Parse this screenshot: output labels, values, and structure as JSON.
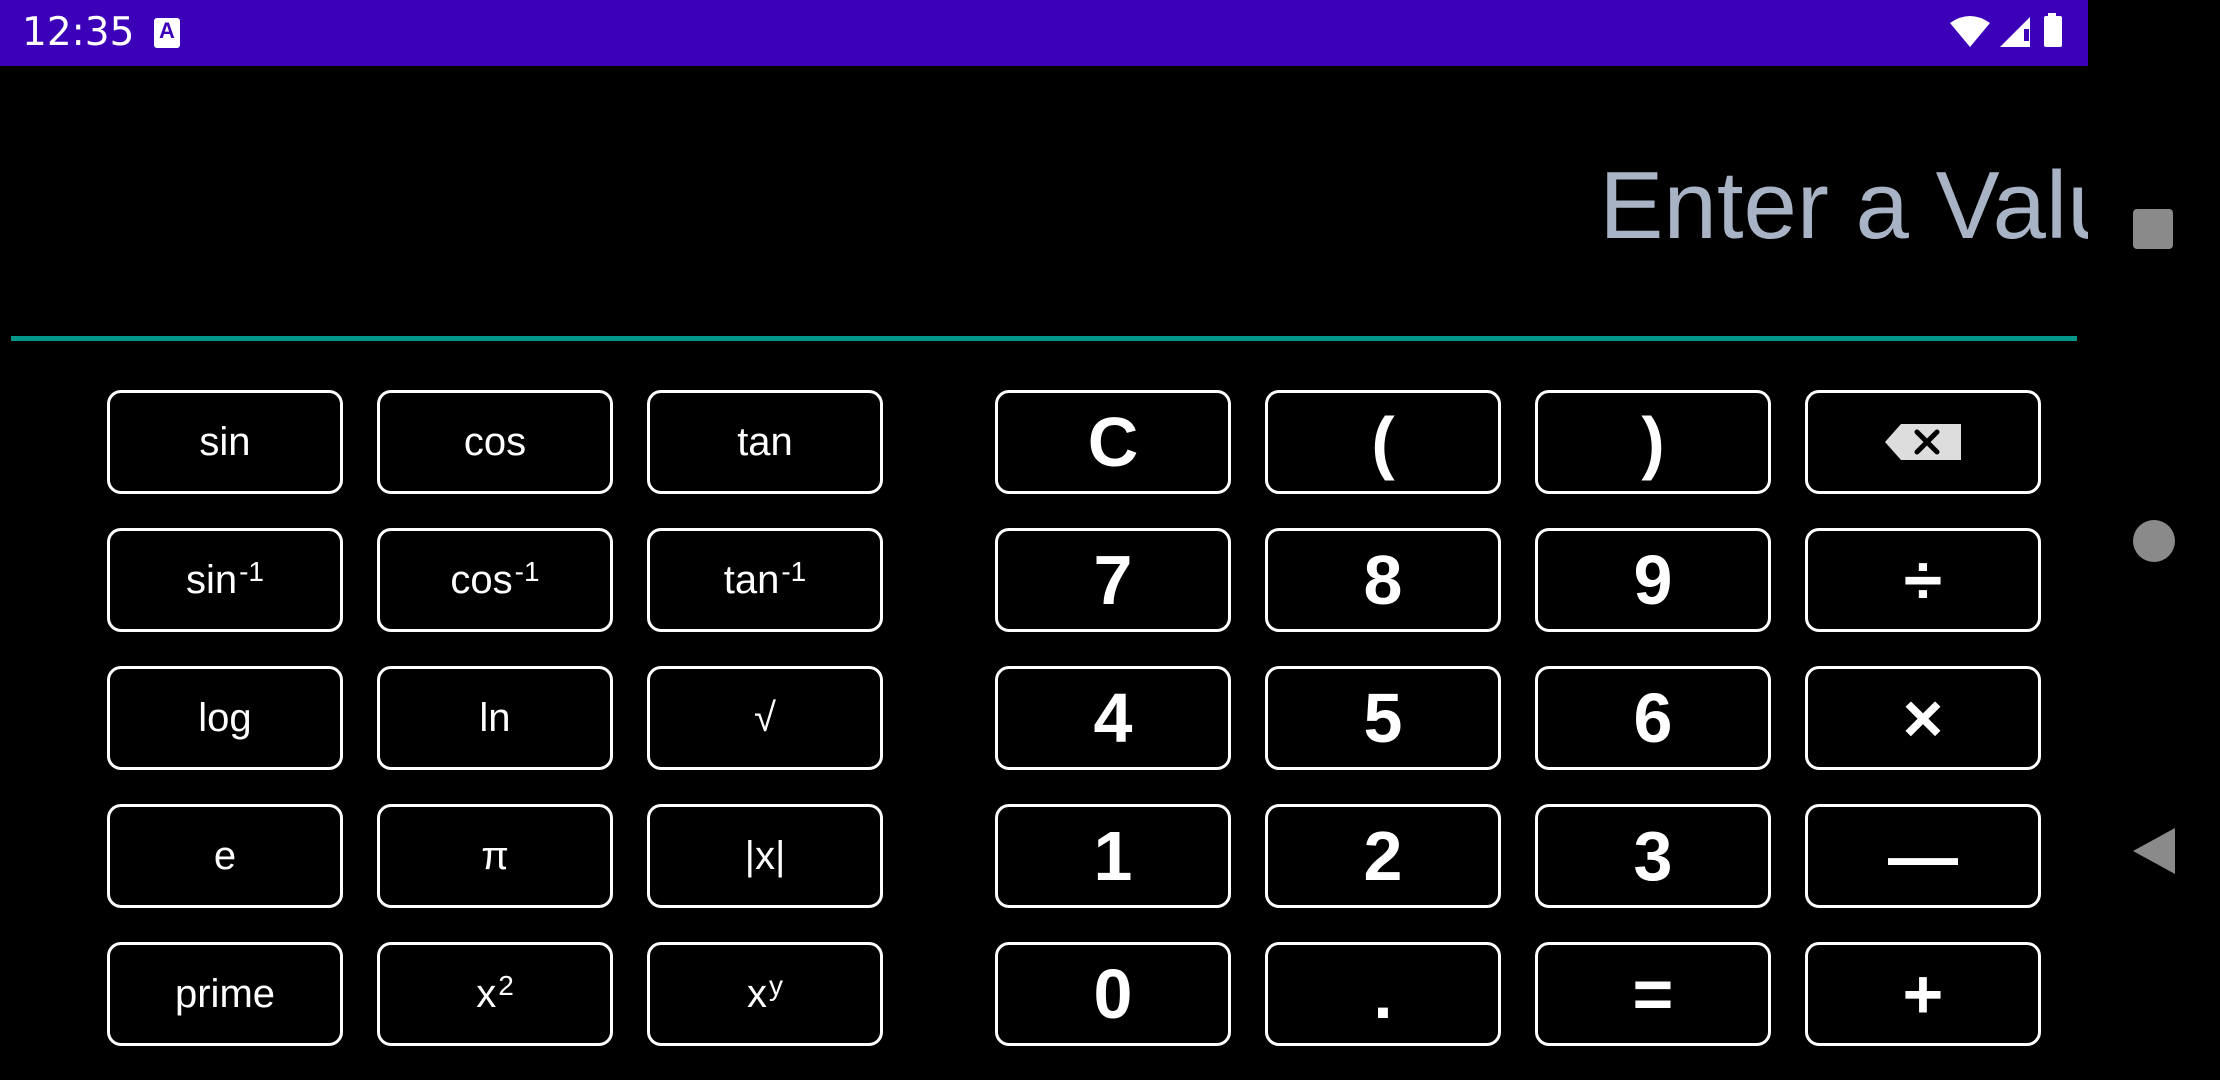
{
  "status_bar": {
    "time": "12:35",
    "notification_glyph": "A",
    "background": "#3b00b8",
    "icons": [
      "wifi-icon",
      "signal-icon",
      "battery-icon"
    ]
  },
  "display": {
    "placeholder": "Enter a Value",
    "value": "",
    "underline_color": "#009688",
    "placeholder_color": "#a9b3c6"
  },
  "scientific_keys": [
    {
      "label": "sin"
    },
    {
      "label": "cos"
    },
    {
      "label": "tan"
    },
    {
      "label": "sin",
      "sup": "-1"
    },
    {
      "label": "cos",
      "sup": "-1"
    },
    {
      "label": "tan",
      "sup": "-1"
    },
    {
      "label": "log"
    },
    {
      "label": "ln"
    },
    {
      "label": "√"
    },
    {
      "label": "e"
    },
    {
      "label": "π"
    },
    {
      "label": "|x|"
    },
    {
      "label": "prime"
    },
    {
      "label": "x",
      "sup": "2"
    },
    {
      "label": "x",
      "sup": "y"
    }
  ],
  "basic_keys": [
    {
      "label": "C"
    },
    {
      "label": "("
    },
    {
      "label": ")"
    },
    {
      "label": "",
      "icon": "backspace-icon"
    },
    {
      "label": "7"
    },
    {
      "label": "8"
    },
    {
      "label": "9"
    },
    {
      "label": "÷"
    },
    {
      "label": "4"
    },
    {
      "label": "5"
    },
    {
      "label": "6"
    },
    {
      "label": "×"
    },
    {
      "label": "1"
    },
    {
      "label": "2"
    },
    {
      "label": "3"
    },
    {
      "label": "—"
    },
    {
      "label": "0"
    },
    {
      "label": "."
    },
    {
      "label": "="
    },
    {
      "label": "+"
    }
  ],
  "navigation": {
    "buttons": [
      "recents-icon",
      "home-icon",
      "back-icon"
    ]
  }
}
